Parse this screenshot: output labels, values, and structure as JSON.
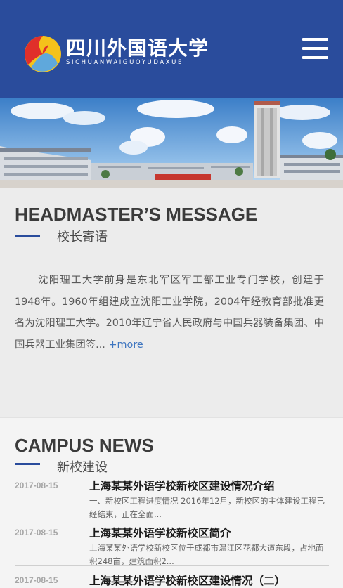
{
  "header": {
    "logo_cn": "四川外国语大学",
    "logo_en": "SICHUANWAIGUOYUDAXUE",
    "menu_icon": "hamburger-menu-icon",
    "colors": {
      "bar": "#2a4c9c"
    }
  },
  "banner": {
    "image": "campus-photo"
  },
  "headmaster": {
    "title": "HEADMASTER’S MESSAGE",
    "subtitle": "校长寄语",
    "body": "沈阳理工大学前身是东北军区军工部工业专门学校，创建于1948年。1960年组建成立沈阳工业学院，2004年经教育部批准更名为沈阳理工大学。2010年辽宁省人民政府与中国兵器装备集团、中国兵器工业集团签...",
    "more": "+more"
  },
  "news": {
    "title": "CAMPUS NEWS",
    "subtitle": "新校建设",
    "items": [
      {
        "date": "2017-08-15",
        "title": "上海某某外语学校新校区建设情况介绍",
        "desc": "一、新校区工程进度情况 2016年12月，新校区的主体建设工程已经结束，正在全面..."
      },
      {
        "date": "2017-08-15",
        "title": "上海某某外语学校新校区简介",
        "desc": "上海某某外语学校新校区位于成都市温江区花都大道东段，占地面积248亩，建筑面积2..."
      },
      {
        "date": "2017-08-15",
        "title": "上海某某外语学校新校区建设情况（二）",
        "desc": ""
      }
    ]
  }
}
